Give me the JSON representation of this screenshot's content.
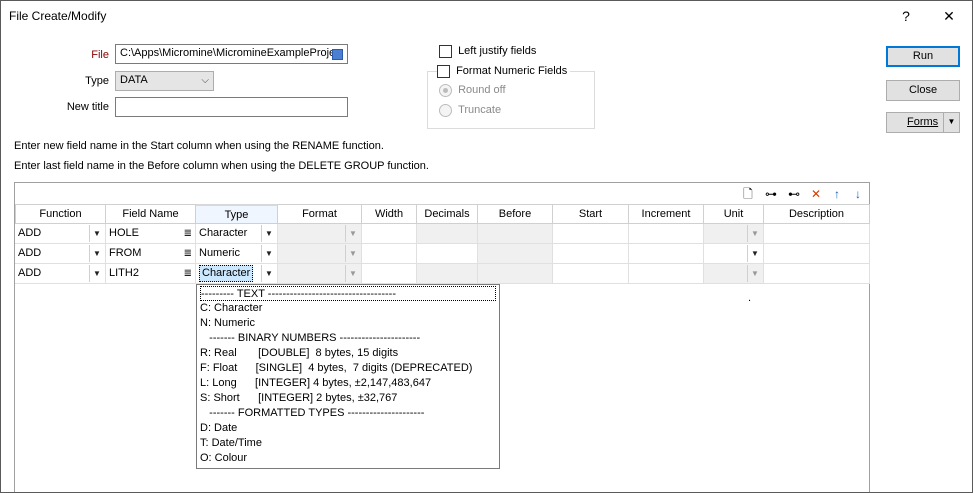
{
  "window": {
    "title": "File Create/Modify",
    "help_label": "?",
    "close_label": "✕"
  },
  "form": {
    "file_label": "File",
    "file_value": "C:\\Apps\\Micromine\\MicromineExampleProje",
    "type_label": "Type",
    "type_value": "DATA",
    "new_title_label": "New title",
    "new_title_value": ""
  },
  "options": {
    "left_justify_label": "Left justify fields",
    "format_numeric_label": "Format Numeric Fields",
    "round_off_label": "Round off",
    "truncate_label": "Truncate"
  },
  "buttons": {
    "run": "Run",
    "close": "Close",
    "forms": "Forms"
  },
  "hints": {
    "line1": "Enter new field name in the Start column when using the RENAME function.",
    "line2": "Enter last field name in the Before column when using the DELETE GROUP function."
  },
  "grid": {
    "columns": [
      "Function",
      "Field Name",
      "Type",
      "Format",
      "Width",
      "Decimals",
      "Before",
      "Start",
      "Increment",
      "Unit",
      "Description"
    ],
    "rows": [
      {
        "function": "ADD",
        "field_name": "HOLE",
        "type": "Character"
      },
      {
        "function": "ADD",
        "field_name": "FROM",
        "type": "Numeric"
      },
      {
        "function": "ADD",
        "field_name": "LITH2",
        "type": "Character"
      }
    ],
    "stray_text": "."
  },
  "type_dropdown": {
    "items": [
      "--------- TEXT -----------------------------------",
      "C: Character",
      "N: Numeric",
      "   ------- BINARY NUMBERS ----------------------",
      "R: Real       [DOUBLE]  8 bytes, 15 digits",
      "F: Float      [SINGLE]  4 bytes,  7 digits (DEPRECATED)",
      "L: Long      [INTEGER] 4 bytes, ±2,147,483,647",
      "S: Short      [INTEGER] 2 bytes, ±32,767",
      "   ------- FORMATTED TYPES ---------------------",
      "D: Date",
      "T: Date/Time",
      "O: Colour"
    ]
  },
  "colors": {
    "accent": "#0078d7",
    "file_label": "#8b0000"
  }
}
